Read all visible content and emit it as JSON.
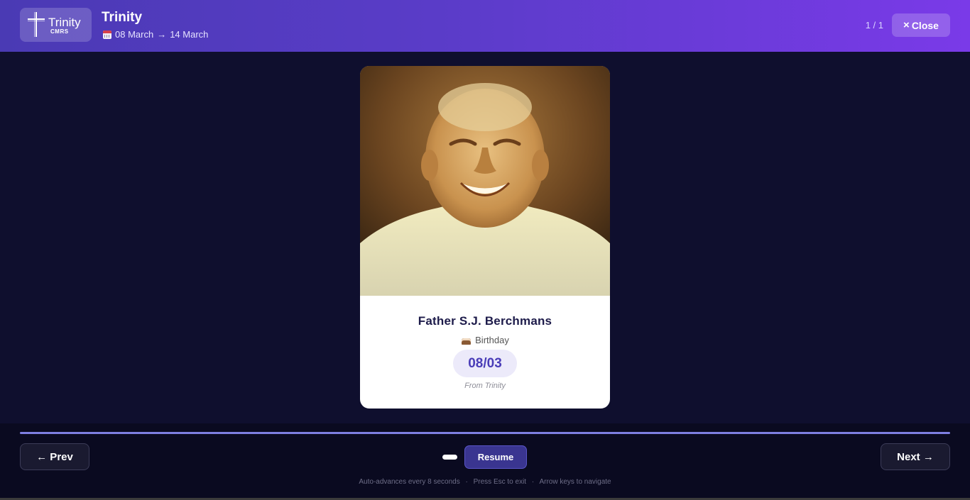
{
  "header": {
    "logo": {
      "word": "Trinity",
      "sub": "CMRS",
      "icon": "cross-icon"
    },
    "title": "Trinity",
    "date_start": "08 March",
    "date_arrow": "→",
    "date_end": "14 March",
    "counter": "1 / 1",
    "close_label": "Close",
    "close_icon": "×"
  },
  "card": {
    "name": "Father S.J. Berchmans",
    "occasion": "Birthday",
    "occasion_icon": "cake-icon",
    "date": "08/03",
    "from": "From Trinity"
  },
  "footer": {
    "prev_label": "← Prev",
    "next_label": "Next →",
    "resume_label": "Resume",
    "progress_fraction": 1.0,
    "hint_1": "Auto-advances every 8 seconds",
    "hint_2": "Press Esc to exit",
    "hint_3": "Arrow keys to navigate",
    "hint_sep": "·"
  },
  "colors": {
    "header_gradient_start": "#4a3ab4",
    "header_gradient_end": "#7a3ae8",
    "accent": "#4a3db8",
    "background": "#0f0f2e"
  }
}
